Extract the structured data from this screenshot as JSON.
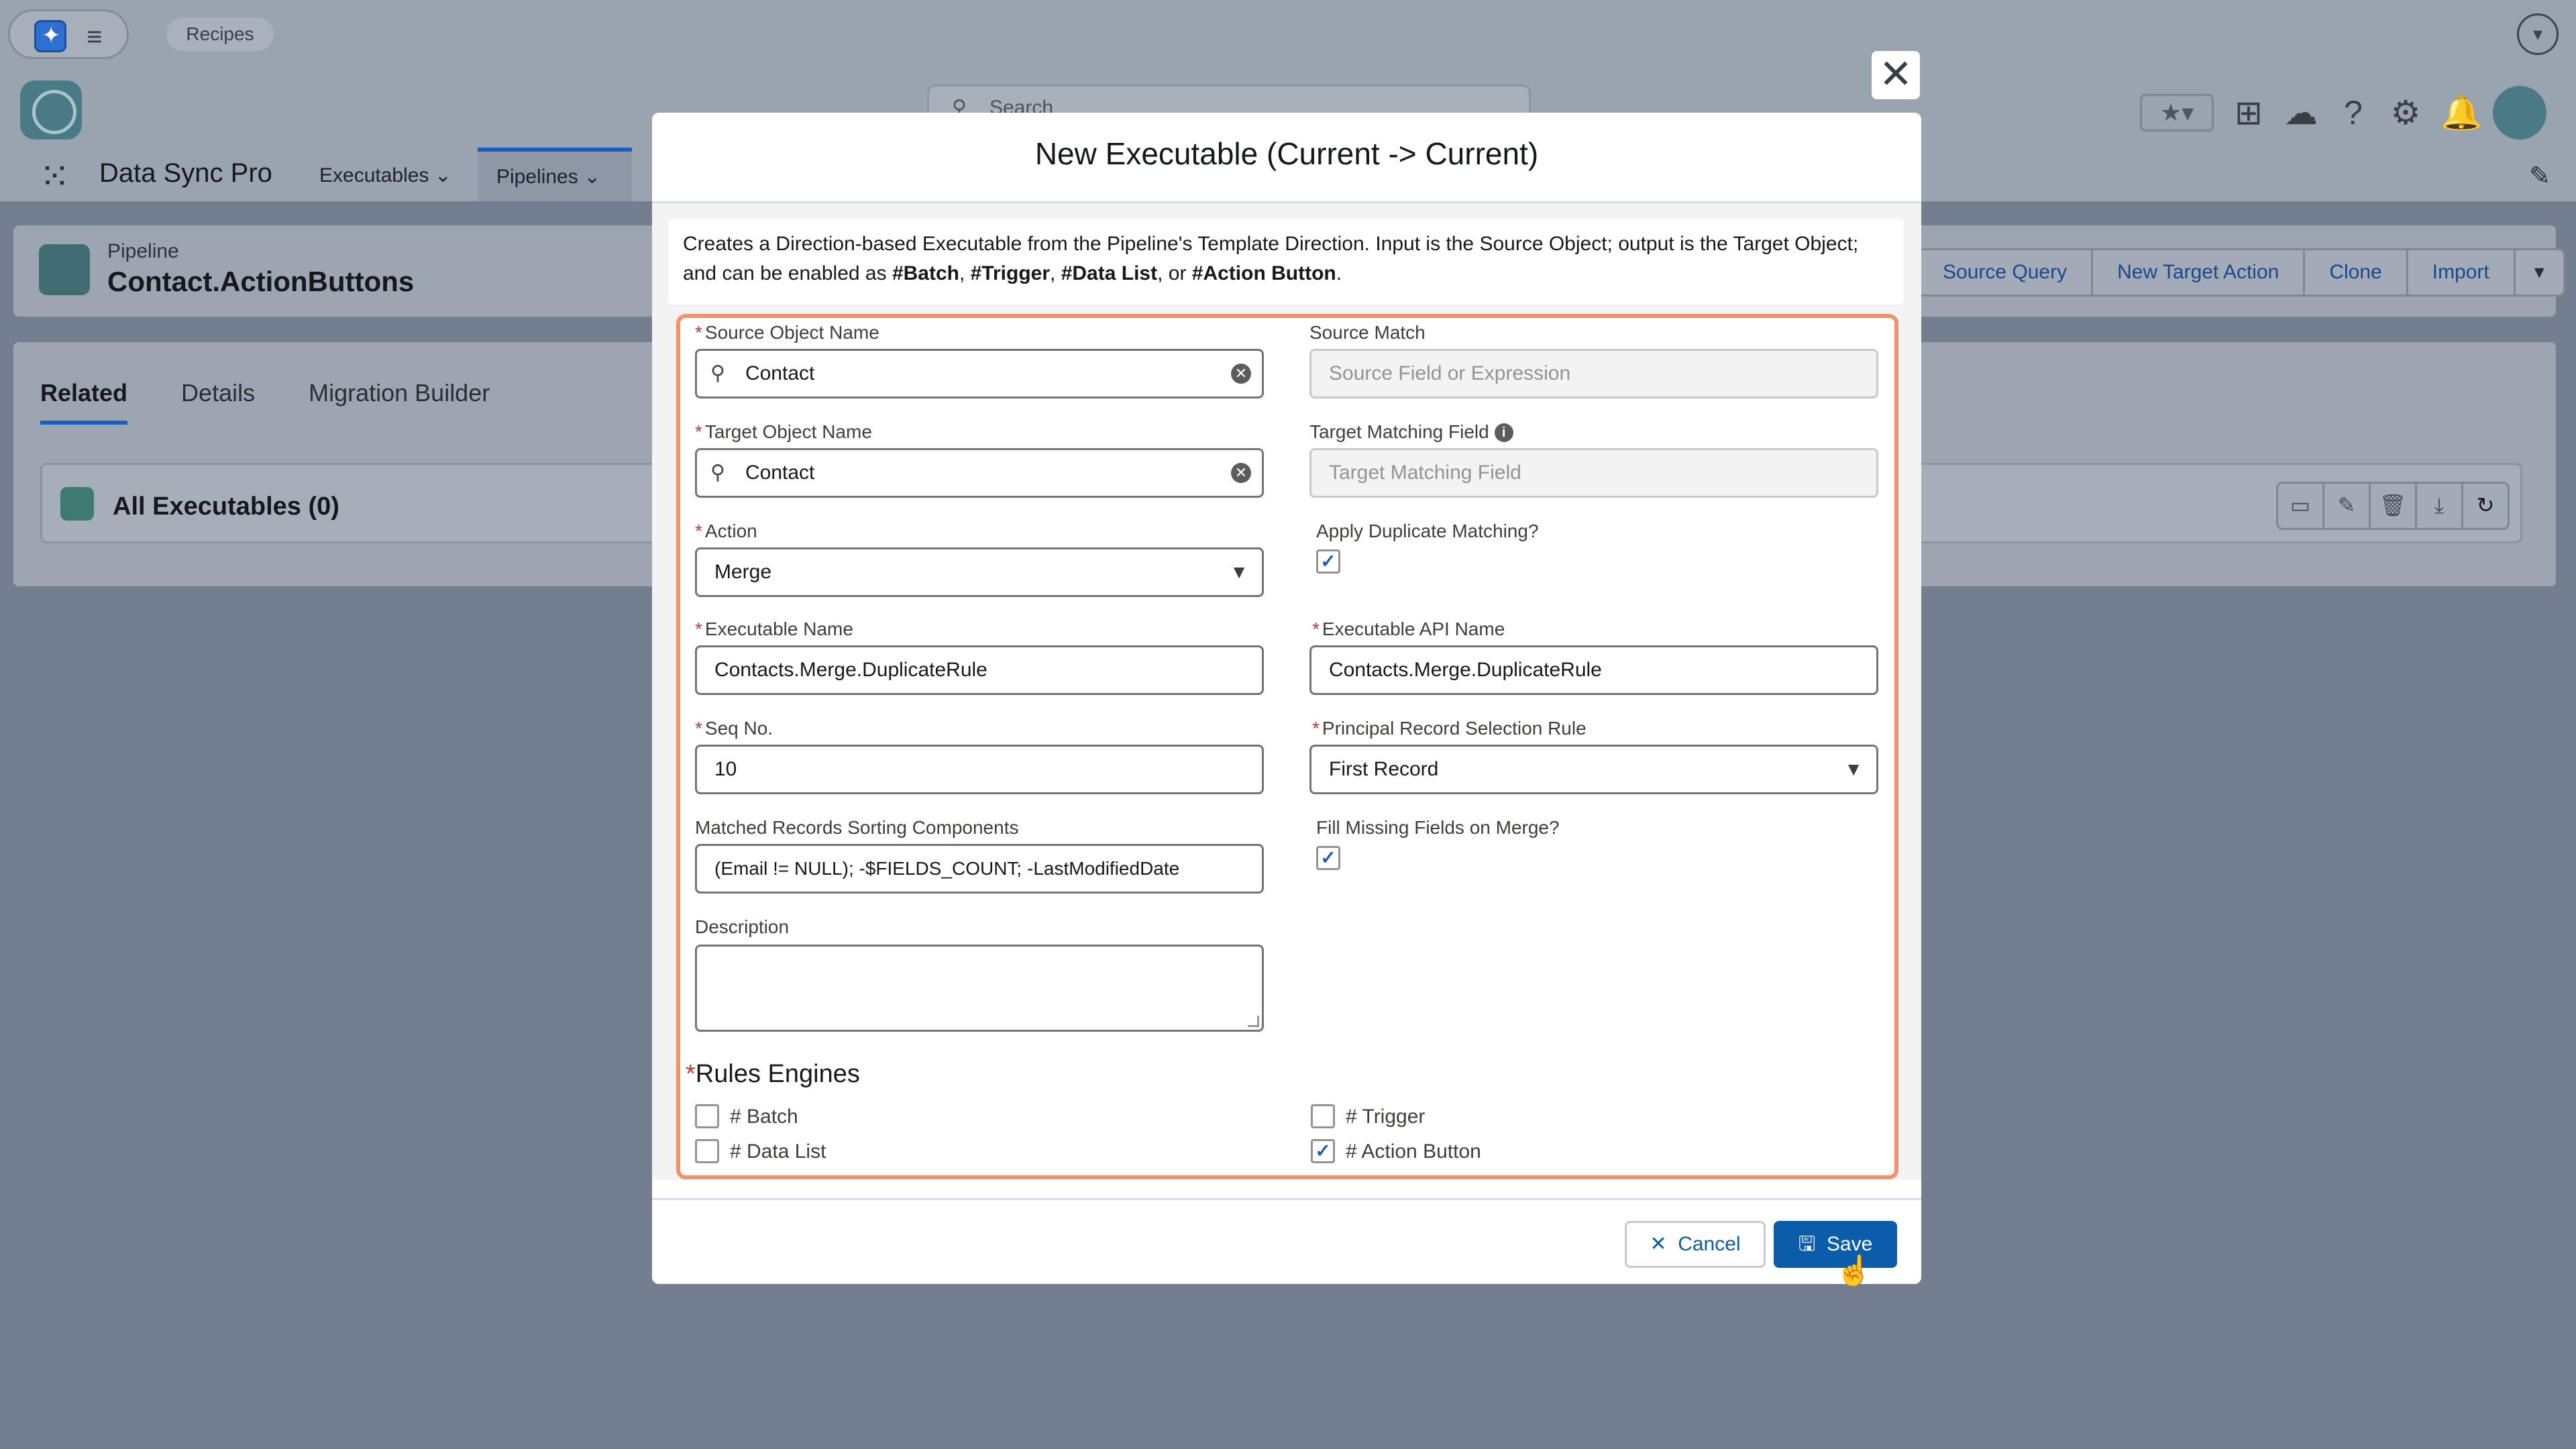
{
  "topbar": {
    "recipes_label": "Recipes",
    "search_placeholder": "Search"
  },
  "nav": {
    "app_name": "Data Sync Pro",
    "items": [
      {
        "label": "Executables"
      },
      {
        "label": "Pipelines"
      }
    ]
  },
  "record": {
    "type_label": "Pipeline",
    "title": "Contact.ActionButtons",
    "actions": [
      "Source Query",
      "New Target Action",
      "Clone",
      "Import"
    ]
  },
  "tabs": [
    "Related",
    "Details",
    "Migration Builder"
  ],
  "related_list": {
    "title": "All Executables (0)"
  },
  "modal": {
    "title": "New Executable (Current -> Current)",
    "info_prefix": "Creates a Direction-based Executable from the Pipeline's Template Direction. Input is the Source Object; output is the Target Object; and can be enabled as ",
    "info_tag_batch": "#Batch",
    "info_sep1": ", ",
    "info_tag_trigger": "#Trigger",
    "info_sep2": ", ",
    "info_tag_datalist": "#Data List",
    "info_sep3": ", or ",
    "info_tag_action": "#Action Button",
    "info_end": ".",
    "fields": {
      "source_object_label": "Source Object Name",
      "source_object_value": "Contact",
      "source_match_label": "Source Match",
      "source_match_placeholder": "Source Field or Expression",
      "target_object_label": "Target Object Name",
      "target_object_value": "Contact",
      "target_matching_label": "Target Matching Field",
      "target_matching_placeholder": "Target Matching Field",
      "action_label": "Action",
      "action_value": "Merge",
      "apply_dup_label": "Apply Duplicate Matching?",
      "exec_name_label": "Executable Name",
      "exec_name_value": "Contacts.Merge.DuplicateRule",
      "exec_api_label": "Executable API Name",
      "exec_api_value": "Contacts.Merge.DuplicateRule",
      "seq_label": "Seq No.",
      "seq_value": "10",
      "principal_label": "Principal Record Selection Rule",
      "principal_value": "First Record",
      "sorting_label": "Matched Records Sorting Components",
      "sorting_value": "(Email != NULL); -$FIELDS_COUNT; -LastModifiedDate",
      "fill_missing_label": "Fill Missing Fields on Merge?",
      "description_label": "Description"
    },
    "rules_engines": {
      "title": "Rules Engines",
      "batch": "# Batch",
      "trigger": "# Trigger",
      "datalist": "# Data List",
      "action_button": "# Action Button"
    },
    "cancel_label": "Cancel",
    "save_label": "Save"
  }
}
